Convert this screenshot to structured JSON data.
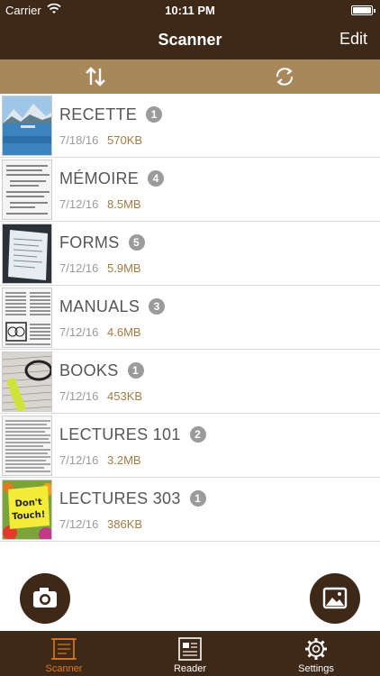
{
  "status_bar": {
    "carrier": "Carrier",
    "time": "10:11 PM"
  },
  "nav": {
    "title": "Scanner",
    "edit_label": "Edit"
  },
  "toolbar": {
    "sort_icon": "sort-arrows-icon",
    "refresh_icon": "refresh-icon"
  },
  "documents": [
    {
      "name": "RECETTE",
      "count": "1",
      "date": "7/18/16",
      "size": "570KB",
      "thumb": "lake"
    },
    {
      "name": "MÉMOIRE",
      "count": "4",
      "date": "7/12/16",
      "size": "8.5MB",
      "thumb": "text"
    },
    {
      "name": "FORMS",
      "count": "5",
      "date": "7/12/16",
      "size": "5.9MB",
      "thumb": "screen"
    },
    {
      "name": "MANUALS",
      "count": "3",
      "date": "7/12/16",
      "size": "4.6MB",
      "thumb": "text"
    },
    {
      "name": "BOOKS",
      "count": "1",
      "date": "7/12/16",
      "size": "453KB",
      "thumb": "glasses"
    },
    {
      "name": "LECTURES 101",
      "count": "2",
      "date": "7/12/16",
      "size": "3.2MB",
      "thumb": "text"
    },
    {
      "name": "LECTURES 303",
      "count": "1",
      "date": "7/12/16",
      "size": "386KB",
      "thumb": "sticky",
      "thumb_text": "Don't Touch!"
    }
  ],
  "tabs": [
    {
      "label": "Scanner",
      "active": true
    },
    {
      "label": "Reader",
      "active": false
    },
    {
      "label": "Settings",
      "active": false
    }
  ],
  "colors": {
    "bar": "#3e2818",
    "toolbar": "#a8875b",
    "accent": "#e07a1e",
    "size_text": "#a17b45"
  }
}
